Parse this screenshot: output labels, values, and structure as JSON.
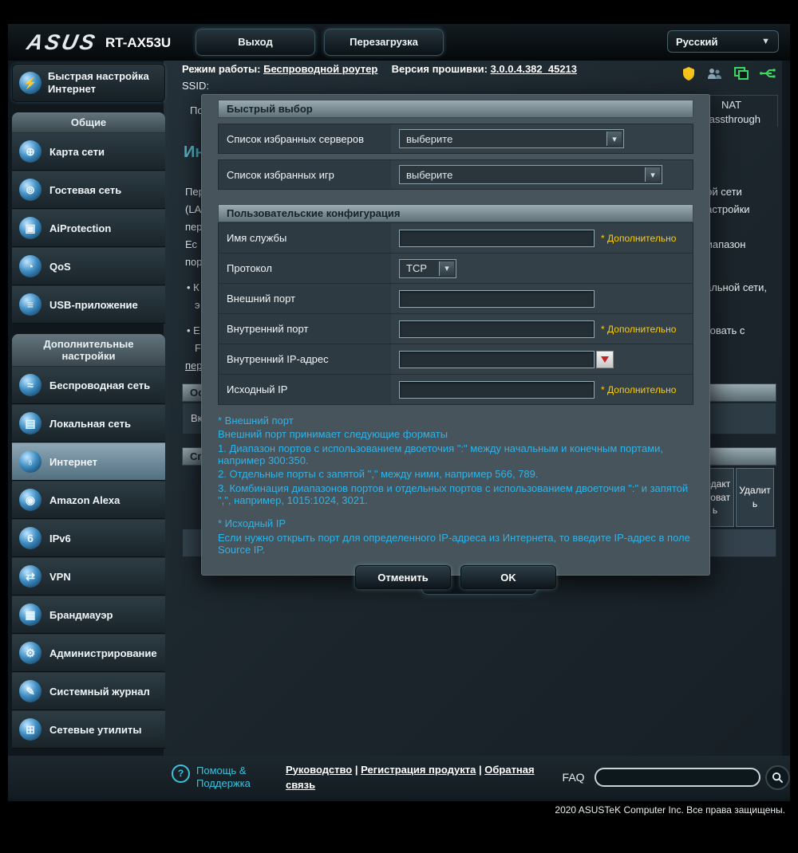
{
  "theme": {
    "accent_cyan": "#2fb3e8",
    "required_yellow": "#ffcc00",
    "shield_yellow": "#f6c41c",
    "status_green": "#3bd65f",
    "header_bar_gray": "#9aabb2",
    "panel_dark": "#2d3a41"
  },
  "icons": {
    "select_arrow": "▾",
    "language_caret": "▼",
    "help_glyph": "?"
  },
  "header": {
    "brand": "ASUS",
    "model": "RT-AX53U",
    "logout": "Выход",
    "reboot": "Перезагрузка",
    "language": "Русский"
  },
  "infobar": {
    "mode_label": "Режим работы:",
    "mode_value": "Беспроводной роутер",
    "fw_label": "Версия прошивки:",
    "fw_value": "3.0.0.4.382_45213",
    "ssid_label": "SSID:"
  },
  "sidebar": {
    "quick_setup": "Быстрая настройка Интернет",
    "quick_glyph": "⚡",
    "sections": [
      {
        "title": "Общие",
        "items": [
          {
            "label": "Карта сети",
            "glyph": "⊕"
          },
          {
            "label": "Гостевая сеть",
            "glyph": "⊚"
          },
          {
            "label": "AiProtection",
            "glyph": "▣"
          },
          {
            "label": "QoS",
            "glyph": "◔"
          },
          {
            "label": "USB-приложение",
            "glyph": "≡"
          }
        ]
      },
      {
        "title": "Дополнительные настройки",
        "items": [
          {
            "label": "Беспроводная сеть",
            "glyph": "≈"
          },
          {
            "label": "Локальная сеть",
            "glyph": "▤"
          },
          {
            "label": "Интернет",
            "glyph": "♁"
          },
          {
            "label": "Amazon Alexa",
            "glyph": "◉"
          },
          {
            "label": "IPv6",
            "glyph": "6"
          },
          {
            "label": "VPN",
            "glyph": "⇄"
          },
          {
            "label": "Брандмауэр",
            "glyph": "▦"
          },
          {
            "label": "Администрирование",
            "glyph": "⚙"
          },
          {
            "label": "Системный журнал",
            "glyph": "✎"
          },
          {
            "label": "Сетевые утилиты",
            "glyph": "⊞"
          }
        ]
      }
    ]
  },
  "background": {
    "tab_left_partial": "Под",
    "tab_nat": "NAT Passthrough",
    "page_title_partial": "Ин",
    "left_fragments": [
      "Пер",
      "(LA",
      "пер",
      "Ес",
      "пор",
      "• К",
      "э",
      "• Е",
      "F",
      "пер"
    ],
    "right_fragments": [
      "ной сети",
      "настройки",
      "диапазон",
      "кальной сети,",
      "ктовать с"
    ],
    "section1_partial": "Ос",
    "row1_partial": "Вк",
    "section2_partial": "Сп",
    "col_edit": "Редактировать",
    "col_delete": "Удалить"
  },
  "modal": {
    "quick_select_title": "Быстрый выбор",
    "favorite_servers_label": "Список избранных серверов",
    "favorite_servers_value": "выберите",
    "favorite_games_label": "Список избранных игр",
    "favorite_games_value": "выберите",
    "custom_title": "Пользовательские конфигурация",
    "rows": [
      {
        "label": "Имя службы",
        "value": "",
        "required": "* Дополнительно"
      },
      {
        "label": "Протокол",
        "value": "TCP"
      },
      {
        "label": "Внешний порт",
        "value": ""
      },
      {
        "label": "Внутренний порт",
        "value": "",
        "required": "* Дополнительно"
      },
      {
        "label": "Внутренний IP-адрес",
        "value": ""
      },
      {
        "label": "Исходный IP",
        "value": "",
        "required": "* Дополнительно"
      }
    ],
    "help_lines": [
      "* Внешний порт",
      "Внешний порт принимает следующие форматы",
      "1. Диапазон портов с использованием двоеточия \":\" между начальным и конечным портами, например 300:350.",
      "2. Отдельные порты с запятой \",\" между ними, например 566, 789.",
      "3. Комбинация диапазонов портов и отдельных портов с использованием двоеточия \":\" и запятой \",\", например, 1015:1024, 3021.",
      "* Исходный IP",
      "Если нужно открыть порт для определенного IP-адреса из Интернета, то введите IP-адрес в поле Source IP."
    ],
    "cancel": "Отменить",
    "ok": "OK"
  },
  "footer": {
    "help_support": "Помощь & Поддержка",
    "links": [
      "Руководство",
      "Регистрация продукта",
      "Обратная связь"
    ],
    "separator": "|",
    "faq": "FAQ",
    "search_value": "",
    "copyright": "2020 ASUSTeK Computer Inc. Все права защищены."
  }
}
